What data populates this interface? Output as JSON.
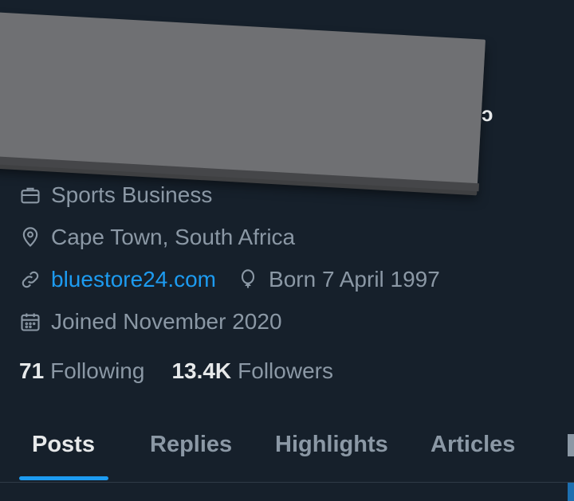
{
  "profile": {
    "category": "Sports Business",
    "location": "Cape Town, South Africa",
    "website": "bluestore24.com",
    "birthday": "Born 7 April 1997",
    "joined": "Joined November 2020"
  },
  "stats": {
    "following_count": "71",
    "following_label": "Following",
    "followers_count": "13.4K",
    "followers_label": "Followers"
  },
  "tabs": [
    {
      "label": "Posts",
      "active": true
    },
    {
      "label": "Replies",
      "active": false
    },
    {
      "label": "Highlights",
      "active": false
    },
    {
      "label": "Articles",
      "active": false
    }
  ],
  "colors": {
    "background": "#16202b",
    "text_primary": "#e7e9ea",
    "text_secondary": "#8b98a5",
    "accent": "#1d9bf0"
  },
  "icons": {
    "category": "briefcase-icon",
    "location": "location-pin-icon",
    "website": "link-icon",
    "birthday": "balloon-icon",
    "joined": "calendar-icon"
  }
}
